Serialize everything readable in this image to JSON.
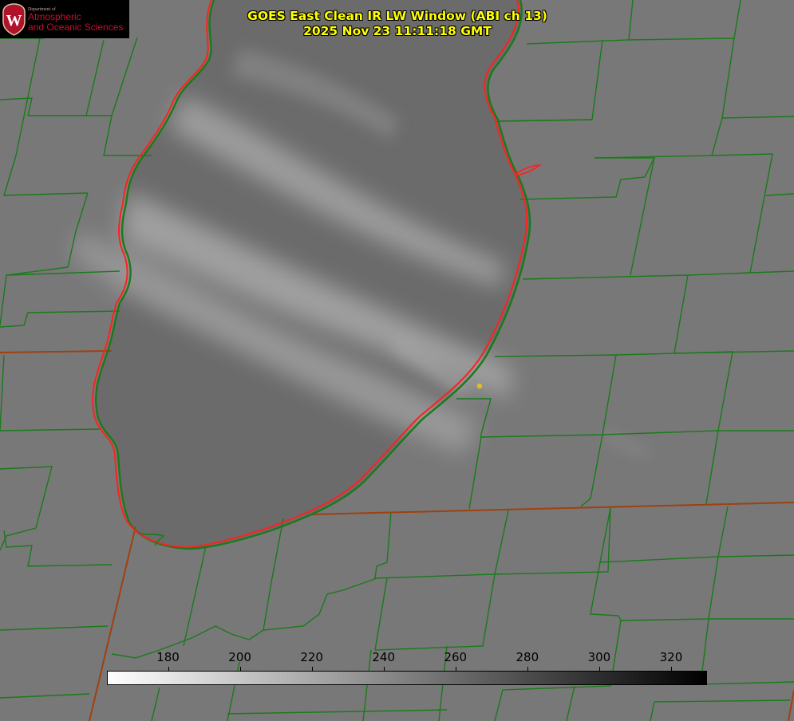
{
  "title": {
    "line1": "GOES East Clean IR LW Window (ABI ch 13)",
    "line2": "2025 Nov 23 11:11:18 GMT"
  },
  "logo": {
    "dept_line": "Department of",
    "name_line1": "Atmospheric",
    "name_line2": "and Oceanic Sciences",
    "seal_letter": "W"
  },
  "colorbar": {
    "min": 163,
    "max": 330,
    "ticks": [
      {
        "value": 180,
        "label": "180"
      },
      {
        "value": 200,
        "label": "200"
      },
      {
        "value": 220,
        "label": "220"
      },
      {
        "value": 240,
        "label": "240"
      },
      {
        "value": 260,
        "label": "260"
      },
      {
        "value": 280,
        "label": "280"
      },
      {
        "value": 300,
        "label": "300"
      },
      {
        "value": 320,
        "label": "320"
      }
    ],
    "gradient_start": "#ffffff",
    "gradient_end": "#000000"
  },
  "colors": {
    "county_lines": "#1a7a1a",
    "state_lines": "#a04010",
    "lake_outline": "#ff2020",
    "lake_fill": "#6a6a6a",
    "land_fill": "#787878",
    "cloud_band": "#a8a8a8",
    "station_marker": "#e0c020"
  }
}
